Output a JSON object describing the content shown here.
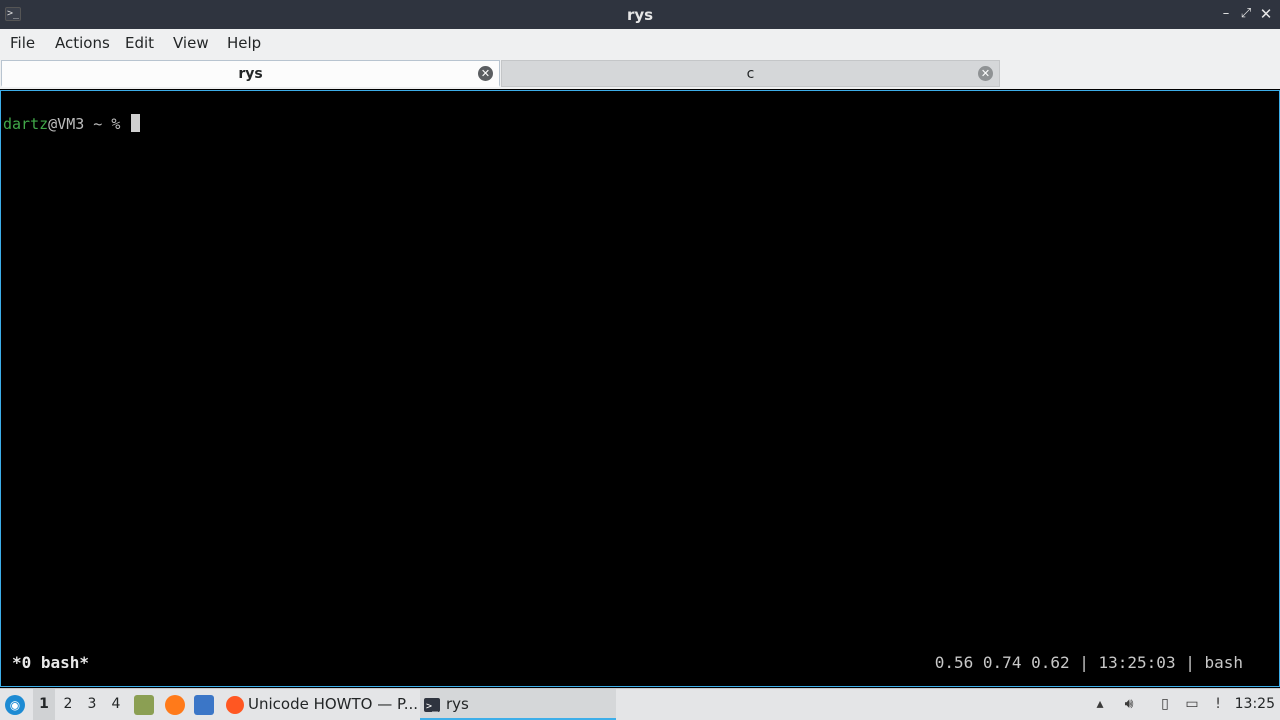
{
  "window": {
    "title": "rys",
    "icon_glyph": ">_",
    "controls": {
      "minimize": "–",
      "maximize": "⤢",
      "close": "✕"
    }
  },
  "menu": {
    "file": "File",
    "actions": "Actions",
    "edit": "Edit",
    "view": "View",
    "help": "Help"
  },
  "tabs": [
    {
      "label": "rys",
      "active": true
    },
    {
      "label": "c",
      "active": false
    }
  ],
  "terminal": {
    "prompt_user": "dartz",
    "prompt_host": "@VM3 ~ % ",
    "status_left": "*0 bash*",
    "status_right": "0.56 0.74 0.62 | 13:25:03 | bash"
  },
  "taskbar": {
    "workspaces": [
      "1",
      "2",
      "3",
      "4"
    ],
    "current_workspace": "1",
    "tasks": [
      {
        "label": "Unicode HOWTO — P...",
        "icon": "firefox-icon"
      },
      {
        "label": "rys",
        "icon": "terminal-icon"
      }
    ],
    "clock": "13:25"
  },
  "colors": {
    "accent": "#3daee9",
    "prompt_user": "#41a849",
    "titlebar": "#2f343f"
  }
}
